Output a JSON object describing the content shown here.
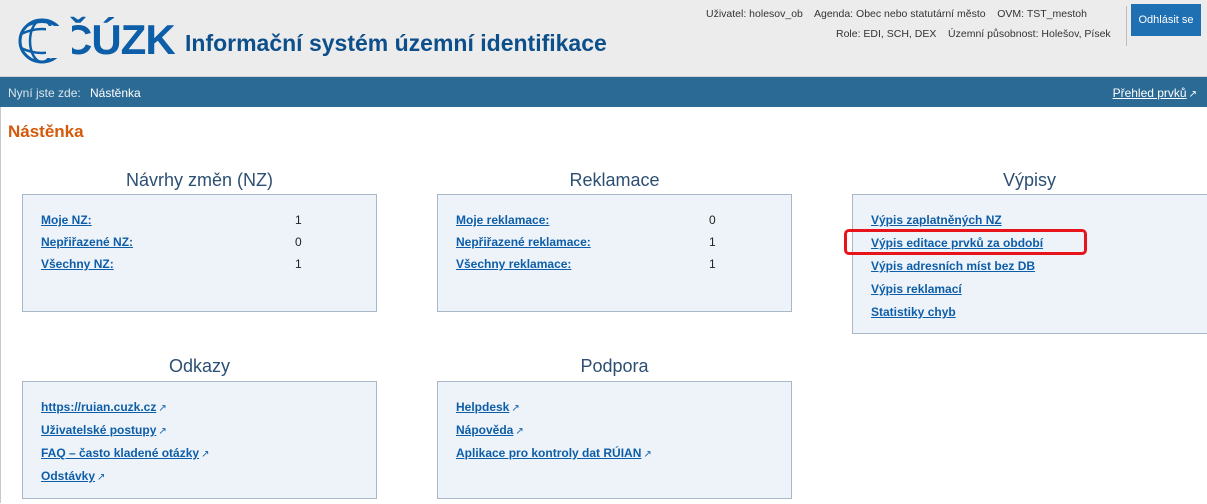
{
  "header": {
    "logo_text": "ČÚZK",
    "app_title": "Informační systém územní identifikace",
    "user_label": "Uživatel: holesov_ob",
    "agenda_label": "Agenda: Obec nebo statutární město",
    "ovm_label": "OVM: TST_mestoh",
    "role_label": "Role: EDI, SCH, DEX",
    "territory_label": "Územní působnost: Holešov, Písek",
    "logout_label": "Odhlásit se",
    "brand_color": "#0d5ea8"
  },
  "nav": {
    "breadcrumb_prefix": "Nyní jste zde:",
    "breadcrumb_current": "Nástěnka",
    "overview_link": "Přehled prvků",
    "bar_color": "#2b6a95"
  },
  "page_title": "Nástěnka",
  "sections": {
    "nz": {
      "title": "Návrhy změn (NZ)",
      "rows": [
        {
          "label": "Moje NZ:",
          "count": "1"
        },
        {
          "label": "Nepřiřazené NZ:",
          "count": "0"
        },
        {
          "label": "Všechny NZ:",
          "count": "1"
        }
      ]
    },
    "reklamace": {
      "title": "Reklamace",
      "rows": [
        {
          "label": "Moje reklamace:",
          "count": "0"
        },
        {
          "label": "Nepřiřazené reklamace:",
          "count": "1"
        },
        {
          "label": "Všechny reklamace:",
          "count": "1"
        }
      ]
    },
    "vypisy": {
      "title": "Výpisy",
      "links": [
        "Výpis zaplatněných NZ",
        "Výpis editace prvků za období",
        "Výpis adresních míst bez DB",
        "Výpis reklamací",
        "Statistiky chyb"
      ]
    },
    "odkazy": {
      "title": "Odkazy",
      "links": [
        "https://ruian.cuzk.cz",
        "Uživatelské postupy",
        "FAQ – často kladené otázky",
        "Odstávky"
      ]
    },
    "podpora": {
      "title": "Podpora",
      "links": [
        "Helpdesk",
        "Nápověda",
        "Aplikace pro kontroly dat RÚIAN"
      ]
    }
  },
  "icons": {
    "external": "↗",
    "logo": "cuzk-logo-icon"
  },
  "highlight_color": "#e8141b"
}
